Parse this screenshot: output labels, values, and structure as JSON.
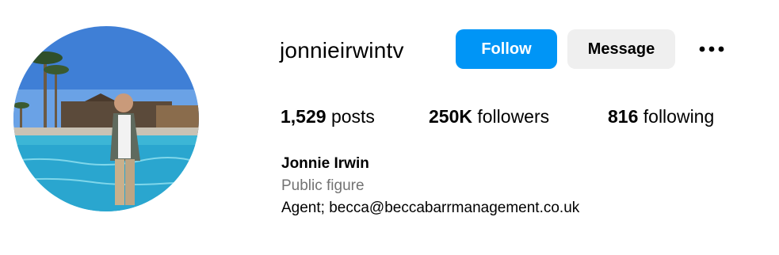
{
  "profile": {
    "username": "jonnieirwintv",
    "full_name": "Jonnie Irwin",
    "category": "Public figure",
    "bio": "Agent; becca@beccabarrmanagement.co.uk"
  },
  "actions": {
    "follow_label": "Follow",
    "message_label": "Message",
    "more_icon": "more-horizontal-icon"
  },
  "stats": {
    "posts_count": "1,529",
    "posts_label": "posts",
    "followers_count": "250K",
    "followers_label": "followers",
    "following_count": "816",
    "following_label": "following"
  },
  "colors": {
    "follow_button": "#0095f6",
    "message_button": "#efefef",
    "category_text": "#737373"
  }
}
